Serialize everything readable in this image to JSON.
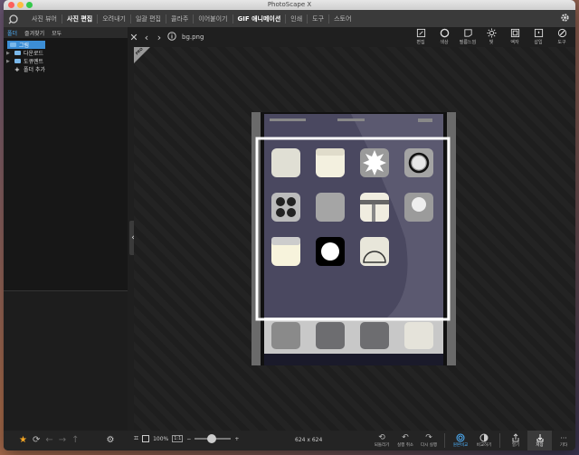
{
  "window": {
    "title": "PhotoScape X"
  },
  "menu": {
    "items": [
      "사진 뷰어",
      "사진 편집",
      "오려내기",
      "일괄 편집",
      "콜라주",
      "이어붙이기",
      "GIF 애니메이션",
      "인쇄",
      "도구",
      "스토어"
    ],
    "active_index": 1
  },
  "left_panel": {
    "tabs": [
      "폴더",
      "즐겨찾기",
      "모두"
    ],
    "tree": [
      {
        "label": "그림",
        "selected": true,
        "icon": "folder-icon"
      },
      {
        "label": "다운로드",
        "icon": "folder-icon"
      },
      {
        "label": "도큐멘트",
        "icon": "folder-icon"
      },
      {
        "label": "폴더 추가",
        "icon": "plus-icon"
      }
    ]
  },
  "editor": {
    "filename": "bg.png",
    "tools": [
      "편집",
      "색상",
      "필름느낌",
      "빛",
      "액자",
      "삽입",
      "도구"
    ],
    "pro_badge": "PRO"
  },
  "bottom": {
    "zoom": "100%",
    "fit_label": "1:1",
    "dimensions": "624 x 624",
    "actions": [
      "되돌리기",
      "실행 취소",
      "다시 실행",
      "원본비교",
      "비교하기",
      "열기",
      "저장",
      "기타"
    ]
  },
  "colors": {
    "accent": "#4fb3ff",
    "selection": "#3c8ed6",
    "favorite_star": "#f5a623"
  }
}
